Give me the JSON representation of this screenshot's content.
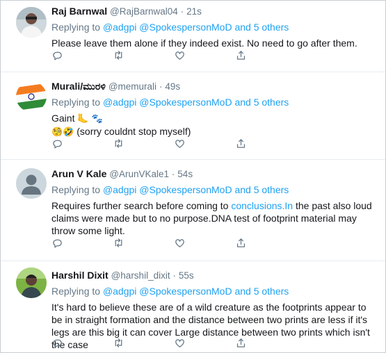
{
  "tweets": [
    {
      "name": "Raj Barnwal",
      "handle": "@RajBarnwal04",
      "dot": "·",
      "time": "21s",
      "reply_prefix": "Replying to",
      "reply_users": "@adgpi @SpokespersonMoD and 5 others",
      "text": "Please leave them alone if they indeed exist. No need to go after them."
    },
    {
      "name": "Murali/ಮುರಳಿ",
      "handle": "@memurali",
      "dot": "·",
      "time": "49s",
      "reply_prefix": "Replying to",
      "reply_users": "@adgpi @SpokespersonMoD and 5 others",
      "line1": "Gaint",
      "line2": "(sorry couldnt stop myself)"
    },
    {
      "name": "Arun V Kale",
      "handle": "@ArunVKale1",
      "dot": "·",
      "time": "54s",
      "reply_prefix": "Replying to",
      "reply_users": "@adgpi @SpokespersonMoD and 5 others",
      "text_before": "Requires further search before coming to ",
      "text_link": "conclusions.In",
      "text_after": " the past also loud claims were made but to no purpose.DNA test of footprint material may throw some light."
    },
    {
      "name": "Harshil Dixit",
      "handle": "@harshil_dixit",
      "dot": "·",
      "time": "55s",
      "reply_prefix": "Replying to",
      "reply_users": "@adgpi @SpokespersonMoD and 5 others",
      "text": "It's hard to believe these are of a wild creature as the footprints appear to be in straight formation and the distance between two prints are less if it's legs are this big it can cover Large distance between two prints which isn't the case"
    }
  ]
}
